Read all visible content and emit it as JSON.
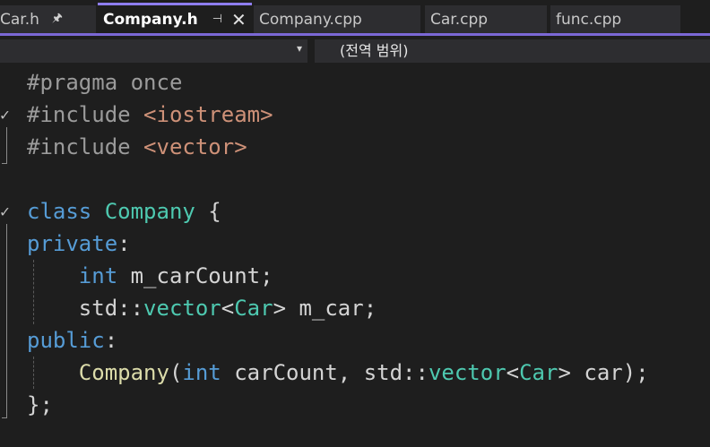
{
  "tabs": [
    {
      "label": "Car.h",
      "pin_icon": "pin-icon"
    },
    {
      "label": "Company.h",
      "pin_icon": "pin-icon",
      "close_icon": "close-icon",
      "active": true
    },
    {
      "label": "Company.cpp"
    },
    {
      "label": "Car.cpp"
    },
    {
      "label": "func.cpp"
    }
  ],
  "navbar": {
    "dropdown_icon": "chevron-down-icon",
    "scope": "(전역 범위)"
  },
  "editor": {
    "lines": [
      [
        {
          "t": "pp",
          "v": "#pragma once"
        }
      ],
      [
        {
          "t": "pp",
          "v": "#include "
        },
        {
          "t": "str",
          "v": "<iostream>"
        }
      ],
      [
        {
          "t": "pp",
          "v": "#include "
        },
        {
          "t": "str",
          "v": "<vector>"
        }
      ],
      [],
      [
        {
          "t": "kw",
          "v": "class "
        },
        {
          "t": "type",
          "v": "Company"
        },
        {
          "t": "plain",
          "v": " {"
        }
      ],
      [
        {
          "t": "kw",
          "v": "private"
        },
        {
          "t": "plain",
          "v": ":"
        }
      ],
      [
        {
          "t": "plain",
          "v": "    "
        },
        {
          "t": "kw",
          "v": "int"
        },
        {
          "t": "plain",
          "v": " m_carCount;"
        }
      ],
      [
        {
          "t": "plain",
          "v": "    std::"
        },
        {
          "t": "type",
          "v": "vector"
        },
        {
          "t": "plain",
          "v": "<"
        },
        {
          "t": "type",
          "v": "Car"
        },
        {
          "t": "plain",
          "v": "> m_car;"
        }
      ],
      [
        {
          "t": "kw",
          "v": "public"
        },
        {
          "t": "plain",
          "v": ":"
        }
      ],
      [
        {
          "t": "plain",
          "v": "    "
        },
        {
          "t": "fn",
          "v": "Company"
        },
        {
          "t": "plain",
          "v": "("
        },
        {
          "t": "kw",
          "v": "int"
        },
        {
          "t": "plain",
          "v": " carCount, std::"
        },
        {
          "t": "type",
          "v": "vector"
        },
        {
          "t": "plain",
          "v": "<"
        },
        {
          "t": "type",
          "v": "Car"
        },
        {
          "t": "plain",
          "v": "> car);"
        }
      ],
      [
        {
          "t": "plain",
          "v": "};"
        }
      ]
    ]
  },
  "colors": {
    "accent": "#7b68d6",
    "background": "#1e1e1e",
    "keyword": "#569cd6",
    "type": "#4ec9b0",
    "string": "#ce9178",
    "function": "#dcdcaa",
    "preprocessor": "#9b9b9b"
  }
}
